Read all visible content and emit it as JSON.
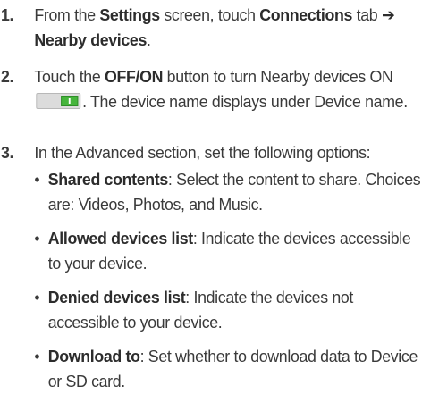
{
  "steps": [
    {
      "number": "1.",
      "parts": [
        {
          "t": "From the ",
          "b": false
        },
        {
          "t": "Settings",
          "b": true
        },
        {
          "t": " screen, touch ",
          "b": false
        },
        {
          "t": "Connections",
          "b": true
        },
        {
          "t": " tab ",
          "b": false
        },
        {
          "t": "➔ Nearby devices",
          "b": true
        },
        {
          "t": ".",
          "b": false
        }
      ]
    },
    {
      "number": "2.",
      "before_toggle": [
        {
          "t": "Touch the ",
          "b": false
        },
        {
          "t": "OFF/ON",
          "b": true
        },
        {
          "t": " button to turn Nearby devices ON",
          "b": false
        }
      ],
      "after_toggle": ". The device name displays under Device name.",
      "toggle_state": "on",
      "toggle_colors": {
        "track": "#dcdcdc",
        "knob": "#46b53c"
      }
    },
    {
      "number": "3.",
      "text": "In the Advanced section, set the following options:"
    }
  ],
  "bullet_char": "•",
  "options": [
    {
      "term": "Shared contents",
      "desc": ": Select the content to share. Choices are: Videos, Photos, and Music."
    },
    {
      "term": "Allowed devices list",
      "desc": ": Indicate the devices accessible to your device."
    },
    {
      "term": "Denied devices list",
      "desc": ": Indicate the devices not accessible to your device."
    },
    {
      "term": "Download to",
      "desc": ": Set whether to download data to Device or SD card."
    }
  ]
}
